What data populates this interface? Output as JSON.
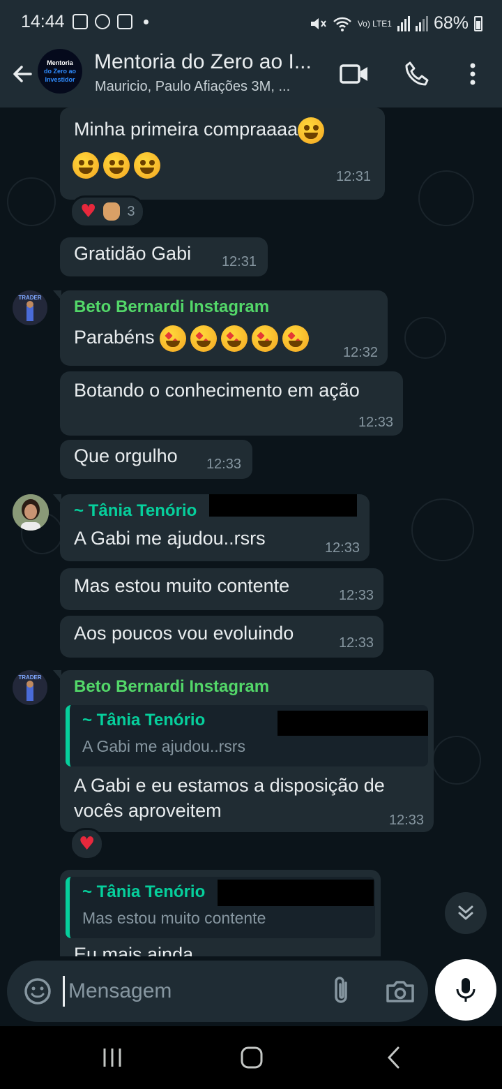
{
  "status_bar": {
    "time": "14:44",
    "network": "Vo) LTE1",
    "battery": "68%"
  },
  "header": {
    "title": "Mentoria do Zero ao I...",
    "subtitle": "Mauricio, Paulo Afiações 3M, ...",
    "avatar_logo": {
      "line1": "Mentoria",
      "line2": "do Zero ao",
      "line3": "Investidor"
    },
    "icons": [
      "back-arrow-icon",
      "video-call-icon",
      "voice-call-icon",
      "more-options-icon"
    ]
  },
  "messages": [
    {
      "text": "Minha primeira compraaaa",
      "time": "12:31",
      "reactions": {
        "count": "3"
      }
    },
    {
      "text": "Gratidão Gabi",
      "time": "12:31"
    },
    {
      "sender": "Beto Bernardi Instagram",
      "sender_color": "#53d769",
      "text": "Parabéns",
      "time": "12:32"
    },
    {
      "text": "Botando o conhecimento em ação",
      "time": "12:33"
    },
    {
      "text": "Que orgulho",
      "time": "12:33"
    },
    {
      "sender": "~ Tânia Tenório",
      "sender_color": "#06cf9c",
      "text": "A Gabi me ajudou..rsrs",
      "time": "12:33"
    },
    {
      "text": "Mas estou muito contente",
      "time": "12:33"
    },
    {
      "text": "Aos poucos vou evoluindo",
      "time": "12:33"
    },
    {
      "sender": "Beto Bernardi Instagram",
      "sender_color": "#53d769",
      "quote": {
        "name": "~ Tânia Tenório",
        "text": "A Gabi me ajudou..rsrs"
      },
      "text_line1": "A Gabi e eu estamos a disposição de",
      "text_line2": "vocês aproveitem",
      "time": "12:33"
    },
    {
      "quote": {
        "name": "~ Tânia Tenório",
        "text": "Mas estou muito contente"
      },
      "text": "Eu mais ainda"
    }
  ],
  "avatars": {
    "beto_label": "TRADER"
  },
  "input": {
    "placeholder": "Mensagem"
  },
  "colors": {
    "background": "#0b141a",
    "bubble": "#202c33",
    "header": "#1f2c34",
    "accent": "#06cf9c"
  }
}
